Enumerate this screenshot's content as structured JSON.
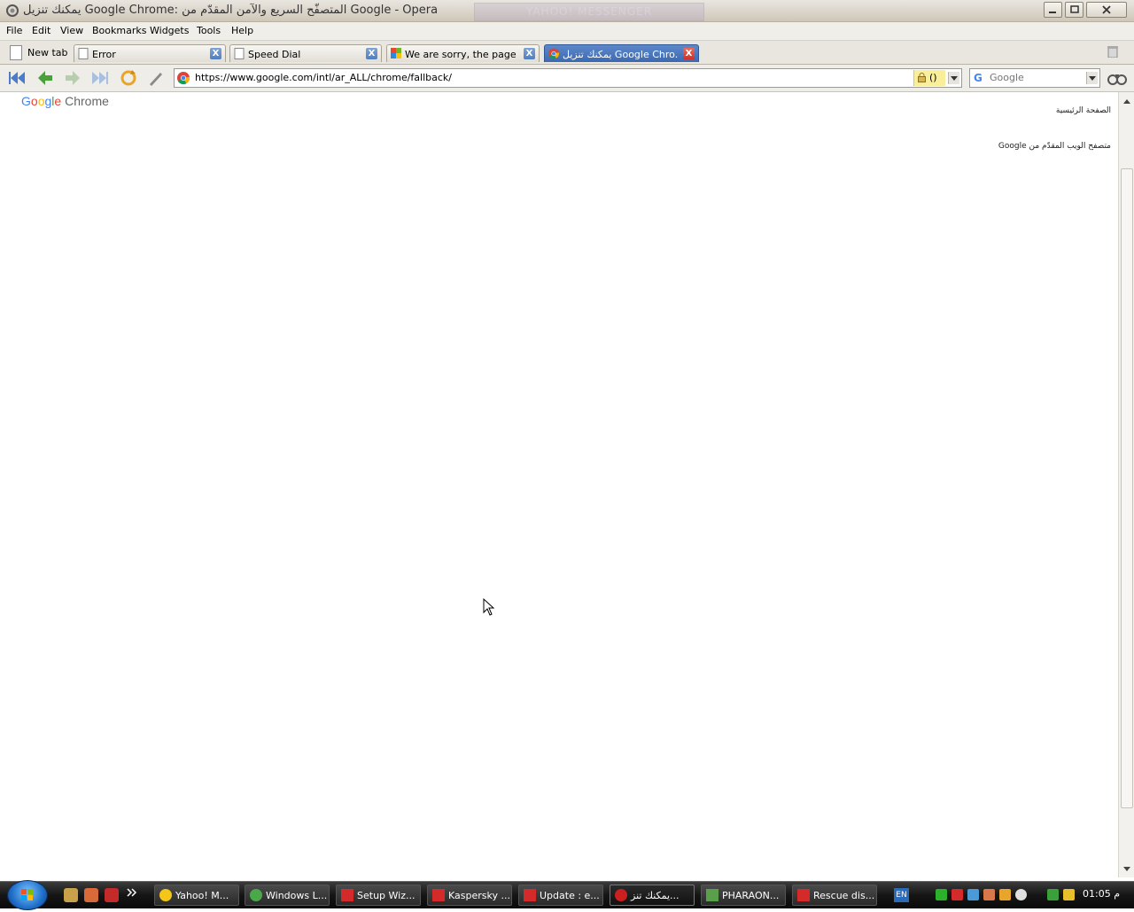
{
  "window": {
    "title": "يمكنك تنزيل Google Chrome: المتصفّح السريع والآمن المقدّم من Google - Opera",
    "ghost_label": "YAHOO! MESSENGER"
  },
  "menu": [
    "File",
    "Edit",
    "View",
    "Bookmarks",
    "Widgets",
    "Tools",
    "Help"
  ],
  "tabs": {
    "new_tab_label": "New tab",
    "items": [
      {
        "label": "Error",
        "close": "X"
      },
      {
        "label": "Speed Dial",
        "close": "X"
      },
      {
        "label": "We are sorry, the page ...",
        "close": "X"
      },
      {
        "label": "يمكنك تنزيل Google Chro...",
        "close": "X",
        "active": true
      }
    ]
  },
  "address": {
    "url": "https://www.google.com/intl/ar_ALL/chrome/fallback/",
    "security_label": "()"
  },
  "search": {
    "placeholder": "Google"
  },
  "page": {
    "logo_google": [
      "G",
      "o",
      "o",
      "g",
      "l",
      "e"
    ],
    "logo_product": "Chrome",
    "home_link": "الصفحة الرئيسية",
    "browser_link": "متصفح الويب المقدّم من Google"
  },
  "taskbar": {
    "tasks": [
      {
        "label": "Yahoo! M...",
        "icon": "yahoo-smiley-icon",
        "color": "#f5c518"
      },
      {
        "label": "Windows L...",
        "icon": "messenger-people-icon",
        "color": "#4aa84a"
      },
      {
        "label": "Setup Wiz...",
        "icon": "kaspersky-k-icon",
        "color": "#d42a2a"
      },
      {
        "label": "Kaspersky ...",
        "icon": "kaspersky-k-icon",
        "color": "#d42a2a"
      },
      {
        "label": "Update : e...",
        "icon": "kaspersky-k-icon",
        "color": "#d42a2a"
      },
      {
        "label": "يمكنك تنز...",
        "icon": "opera-icon",
        "color": "#cc1f1f",
        "active": true
      },
      {
        "label": "PHARAON...",
        "icon": "pharaon-icon",
        "color": "#5aa04a"
      },
      {
        "label": "Rescue dis...",
        "icon": "kaspersky-k-icon",
        "color": "#d42a2a"
      }
    ],
    "language": "EN",
    "clock": "01:05 م",
    "colors": {
      "accent": "#3b69b2",
      "tab_close": "#d0302a"
    }
  }
}
